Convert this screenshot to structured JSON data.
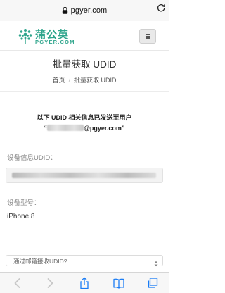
{
  "browser": {
    "url": "pgyer.com"
  },
  "header": {
    "logo_cn": "蒲公英",
    "logo_en": "PGYER.COM"
  },
  "page": {
    "title": "批量获取 UDID",
    "breadcrumb": [
      "首页",
      "批量获取 UDID"
    ]
  },
  "notice": {
    "line1": "以下 UDID 相关信息已发送至用户",
    "email_prefix": "“",
    "email_suffix": "@pgyer.com”"
  },
  "form": {
    "udid_label": "设备信息UDID：",
    "model_label": "设备型号：",
    "model_value": "iPhone 8",
    "select_placeholder": "通过邮箱接收UDID?"
  },
  "colors": {
    "brand": "#2fa58c",
    "ios_blue": "#1a7cf5"
  }
}
